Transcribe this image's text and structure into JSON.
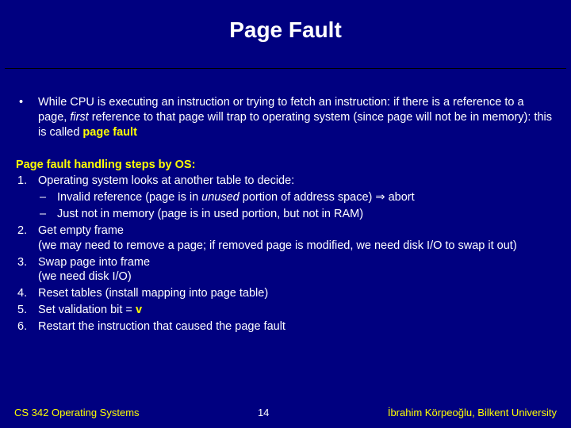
{
  "title": "Page Fault",
  "bullet": {
    "pre": "While CPU is executing an instruction or trying to fetch an instruction: if there is a reference to a page, ",
    "first": "first",
    "mid": " reference to that page will trap to operating system (since page will not be in memory): this is called ",
    "pf": "page fault"
  },
  "heading": "Page fault handling steps by OS:",
  "steps": {
    "s1": {
      "num": "1.",
      "text": "Operating system looks at another table to decide:",
      "sub1": {
        "dash": "–",
        "pre": "Invalid reference (page is in ",
        "unused": "unused",
        "mid": " portion of address space) ",
        "arrow": "⇒",
        "post": " abort"
      },
      "sub2": {
        "dash": "–",
        "text": "Just not in memory (page is in used portion, but not in RAM)"
      }
    },
    "s2": {
      "num": "2.",
      "line1": "Get empty frame",
      "line2": "(we may need to remove a page; if removed page is modified, we need disk I/O to swap it out)"
    },
    "s3": {
      "num": "3.",
      "line1": "Swap page into frame",
      "line2": "(we need disk I/O)"
    },
    "s4": {
      "num": "4.",
      "text": "Reset tables (install mapping into page table)"
    },
    "s5": {
      "num": "5.",
      "pre": "Set validation bit = ",
      "v": "v"
    },
    "s6": {
      "num": "6.",
      "text": "Restart the instruction that caused the page fault"
    }
  },
  "footer": {
    "left": "CS 342 Operating Systems",
    "center": "14",
    "right": "İbrahim Körpeoğlu, Bilkent University"
  }
}
